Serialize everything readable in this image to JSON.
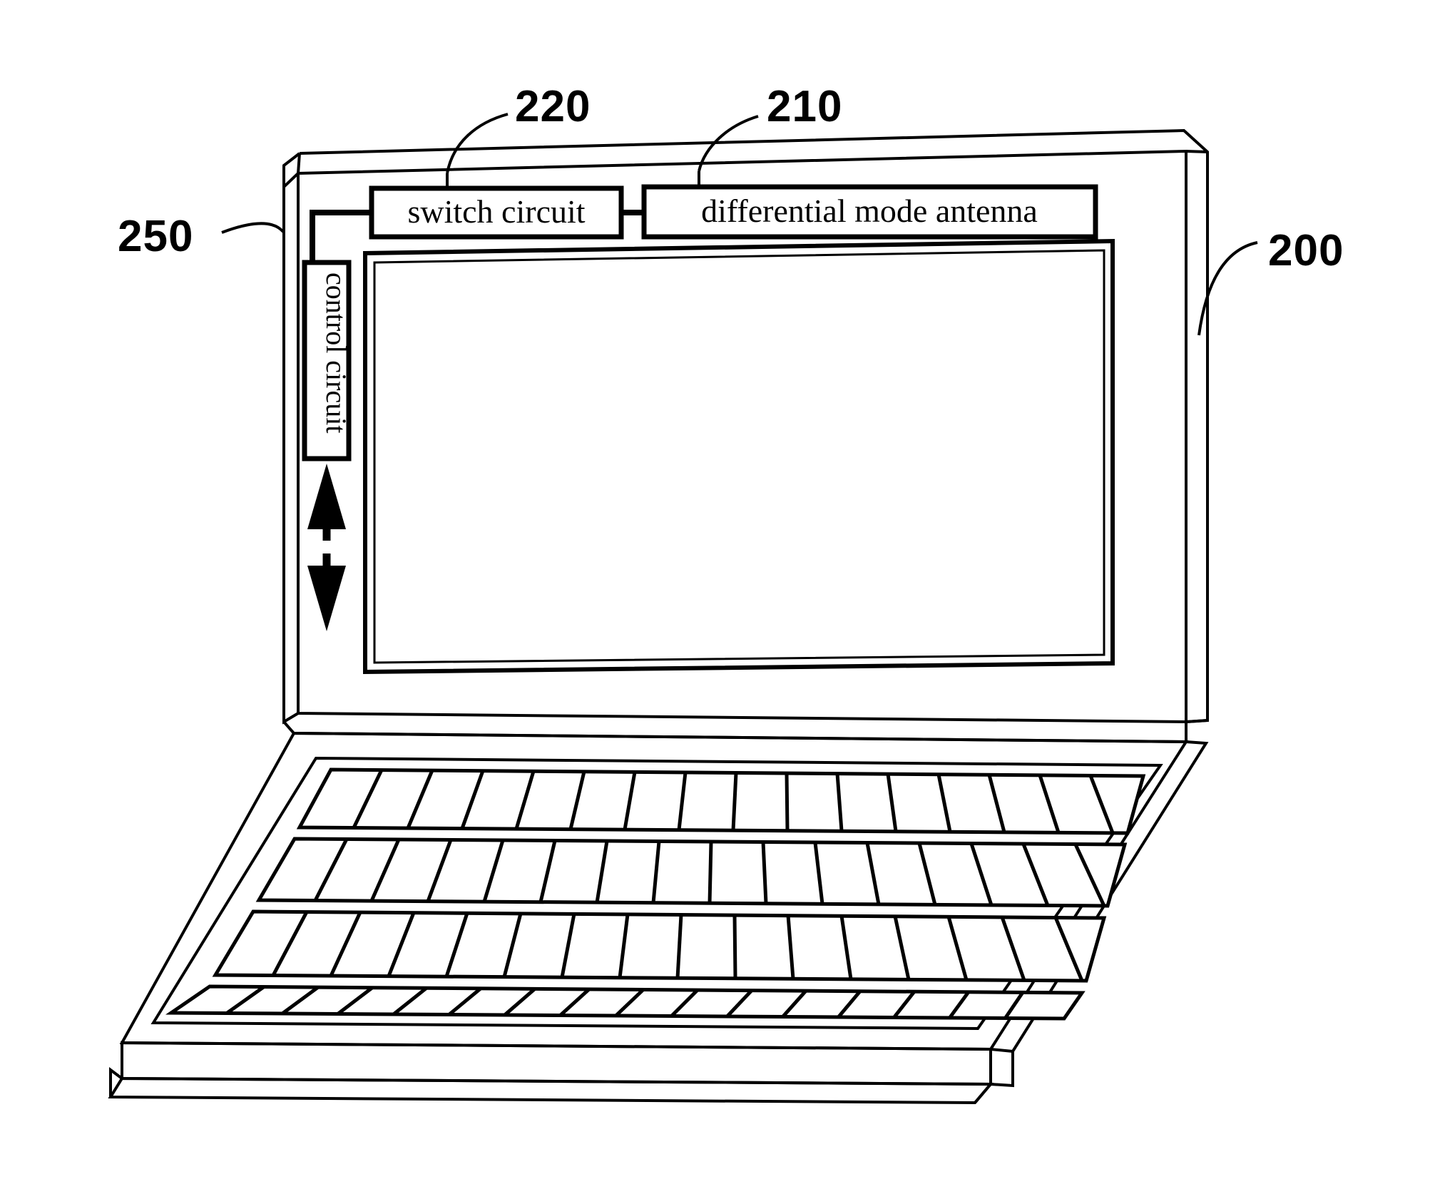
{
  "figure": {
    "type": "patent-line-drawing",
    "subject": "laptop computer with differential mode antenna",
    "background_color": "#ffffff",
    "line_color": "#000000"
  },
  "blocks": [
    {
      "id": "switch-circuit",
      "label": "switch circuit",
      "ref": "220",
      "orientation": "horizontal"
    },
    {
      "id": "differential-mode-antenna",
      "label": "differential mode antenna",
      "ref": "210",
      "orientation": "horizontal"
    },
    {
      "id": "control-circuit",
      "label": "control circuit",
      "ref": "250",
      "orientation": "vertical"
    }
  ],
  "reference_numerals": [
    {
      "id": "ref-220",
      "value": "220",
      "points_to": "switch circuit block"
    },
    {
      "id": "ref-210",
      "value": "210",
      "points_to": "differential mode antenna block"
    },
    {
      "id": "ref-250",
      "value": "250",
      "points_to": "control circuit block"
    },
    {
      "id": "ref-200",
      "value": "200",
      "points_to": "laptop housing"
    }
  ],
  "annotations": {
    "movement_arrow": {
      "style": "double-headed dashed vertical arrow",
      "meaning": "slidable travel of control circuit"
    }
  },
  "keyboard": {
    "rows": 4,
    "columns": 16
  }
}
